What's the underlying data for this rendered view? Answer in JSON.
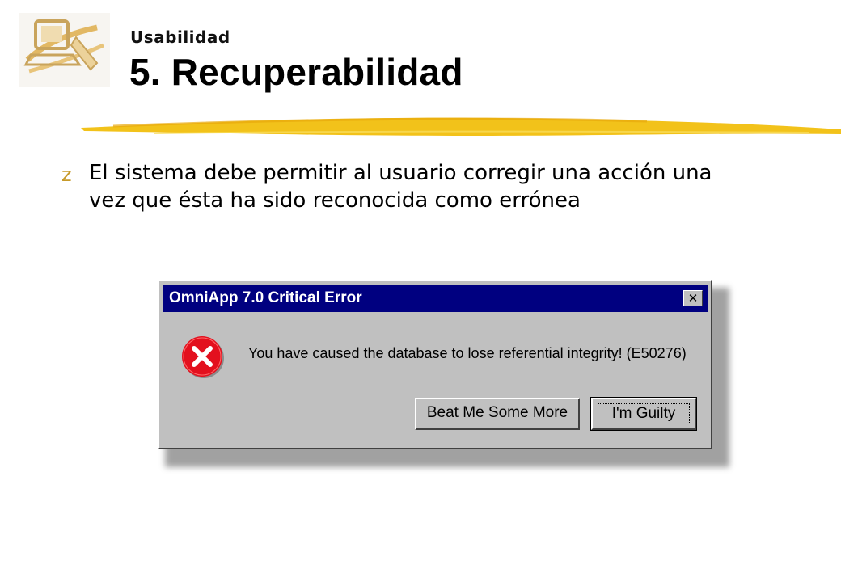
{
  "slide": {
    "subtitle": "Usabilidad",
    "title": "5. Recuperabilidad",
    "bullet_marker": "z",
    "bullet_text": "El sistema debe permitir al usuario corregir una acción una vez que ésta ha sido reconocida como errónea"
  },
  "dialog": {
    "title": "OmniApp 7.0 Critical Error",
    "close_label": "✕",
    "message": "You have caused the database to lose referential integrity! (E50276)",
    "buttons": {
      "more_label": "Beat Me Some More",
      "guilty_label": "I'm Guilty"
    }
  },
  "colors": {
    "accent": "#f2c21a",
    "titlebar": "#000080",
    "dialog_face": "#c0c0c0",
    "error": "#e3101e"
  }
}
